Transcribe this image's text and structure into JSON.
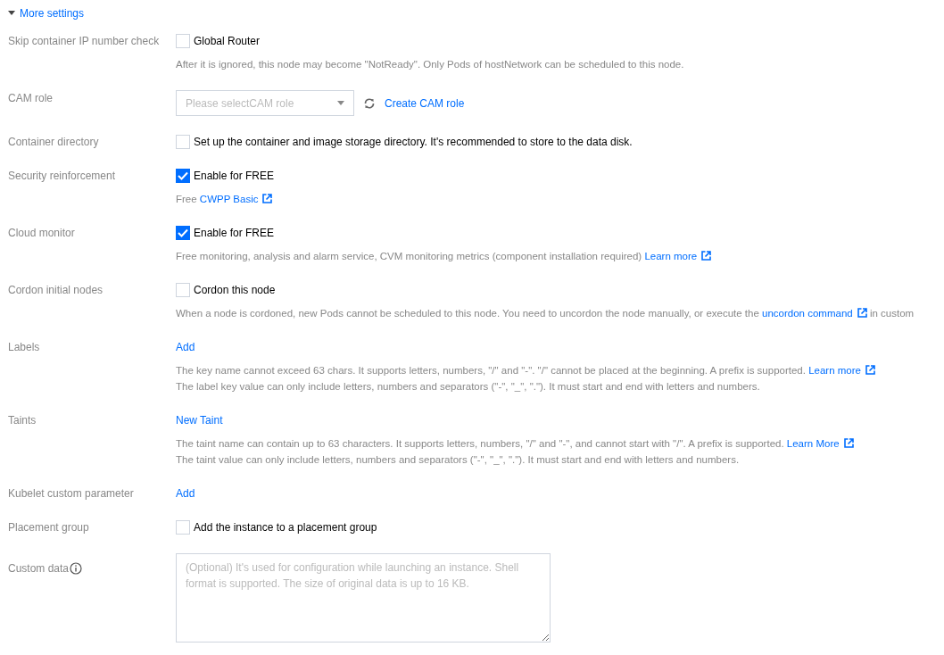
{
  "more_settings": {
    "label": "More settings",
    "expanded": true
  },
  "rows": [
    {
      "label": "Skip container IP number check",
      "items": [
        {
          "kind": "checkbox",
          "label": "Global Router",
          "checked": false
        },
        {
          "kind": "help",
          "lines": [
            [
              {
                "kind": "text",
                "text": "After it is ignored, this node may become \"NotReady\". Only Pods of hostNetwork can be scheduled to this node."
              }
            ]
          ]
        }
      ]
    },
    {
      "label": "CAM role",
      "items": [
        {
          "kind": "select",
          "placeholder": "Please selectCAM role",
          "action": "Create CAM role"
        }
      ]
    },
    {
      "label": "Container directory",
      "items": [
        {
          "kind": "checkbox",
          "label": "Set up the container and image storage directory. It's recommended to store to the data disk.",
          "checked": false
        }
      ]
    },
    {
      "label": "Security reinforcement",
      "items": [
        {
          "kind": "checkbox",
          "label": "Enable for FREE",
          "checked": true
        },
        {
          "kind": "help",
          "lines": [
            [
              {
                "kind": "text",
                "text": "Free "
              },
              {
                "kind": "link",
                "text": "CWPP Basic"
              }
            ]
          ]
        }
      ]
    },
    {
      "label": "Cloud monitor",
      "items": [
        {
          "kind": "checkbox",
          "label": "Enable for FREE",
          "checked": true
        },
        {
          "kind": "help",
          "lines": [
            [
              {
                "kind": "text",
                "text": "Free monitoring, analysis and alarm service, CVM monitoring metrics (component installation required) "
              },
              {
                "kind": "link",
                "text": "Learn more"
              }
            ]
          ]
        }
      ]
    },
    {
      "label": "Cordon initial nodes",
      "items": [
        {
          "kind": "checkbox",
          "label": "Cordon this node",
          "checked": false
        },
        {
          "kind": "help",
          "lines": [
            [
              {
                "kind": "text",
                "text": "When a node is cordoned, new Pods cannot be scheduled to this node. You need to uncordon the node manually, or execute the "
              },
              {
                "kind": "link",
                "text": "uncordon command"
              },
              {
                "kind": "text",
                "text": " in custom"
              }
            ]
          ]
        }
      ]
    },
    {
      "label": "Labels",
      "items": [
        {
          "kind": "link",
          "text": "Add"
        },
        {
          "kind": "help",
          "lines": [
            [
              {
                "kind": "text",
                "text": "The key name cannot exceed 63 chars. It supports letters, numbers, \"/\" and \"-\". \"/\" cannot be placed at the beginning. A prefix is supported. "
              },
              {
                "kind": "link",
                "text": "Learn more"
              }
            ],
            [
              {
                "kind": "text",
                "text": "The label key value can only include letters, numbers and separators (\"-\", \"_\", \".\"). It must start and end with letters and numbers."
              }
            ]
          ]
        }
      ]
    },
    {
      "label": "Taints",
      "items": [
        {
          "kind": "link",
          "text": "New Taint"
        },
        {
          "kind": "help",
          "lines": [
            [
              {
                "kind": "text",
                "text": "The taint name can contain up to 63 characters. It supports letters, numbers, \"/\" and \"-\", and cannot start with \"/\". A prefix is supported. "
              },
              {
                "kind": "link",
                "text": "Learn More"
              }
            ],
            [
              {
                "kind": "text",
                "text": "The taint value can only include letters, numbers and separators (\"-\", \"_\", \".\"). It must start and end with letters and numbers."
              }
            ]
          ]
        }
      ]
    },
    {
      "label": "Kubelet custom parameter",
      "items": [
        {
          "kind": "link",
          "text": "Add"
        }
      ]
    },
    {
      "label": "Placement group",
      "items": [
        {
          "kind": "checkbox",
          "label": "Add the instance to a placement group",
          "checked": false
        }
      ]
    },
    {
      "label": "Custom data",
      "info": true,
      "items": [
        {
          "kind": "textarea",
          "placeholder": "(Optional) It's used for configuration while launching an instance. Shell format is supported. The size of original data is up to 16 KB."
        }
      ]
    }
  ]
}
